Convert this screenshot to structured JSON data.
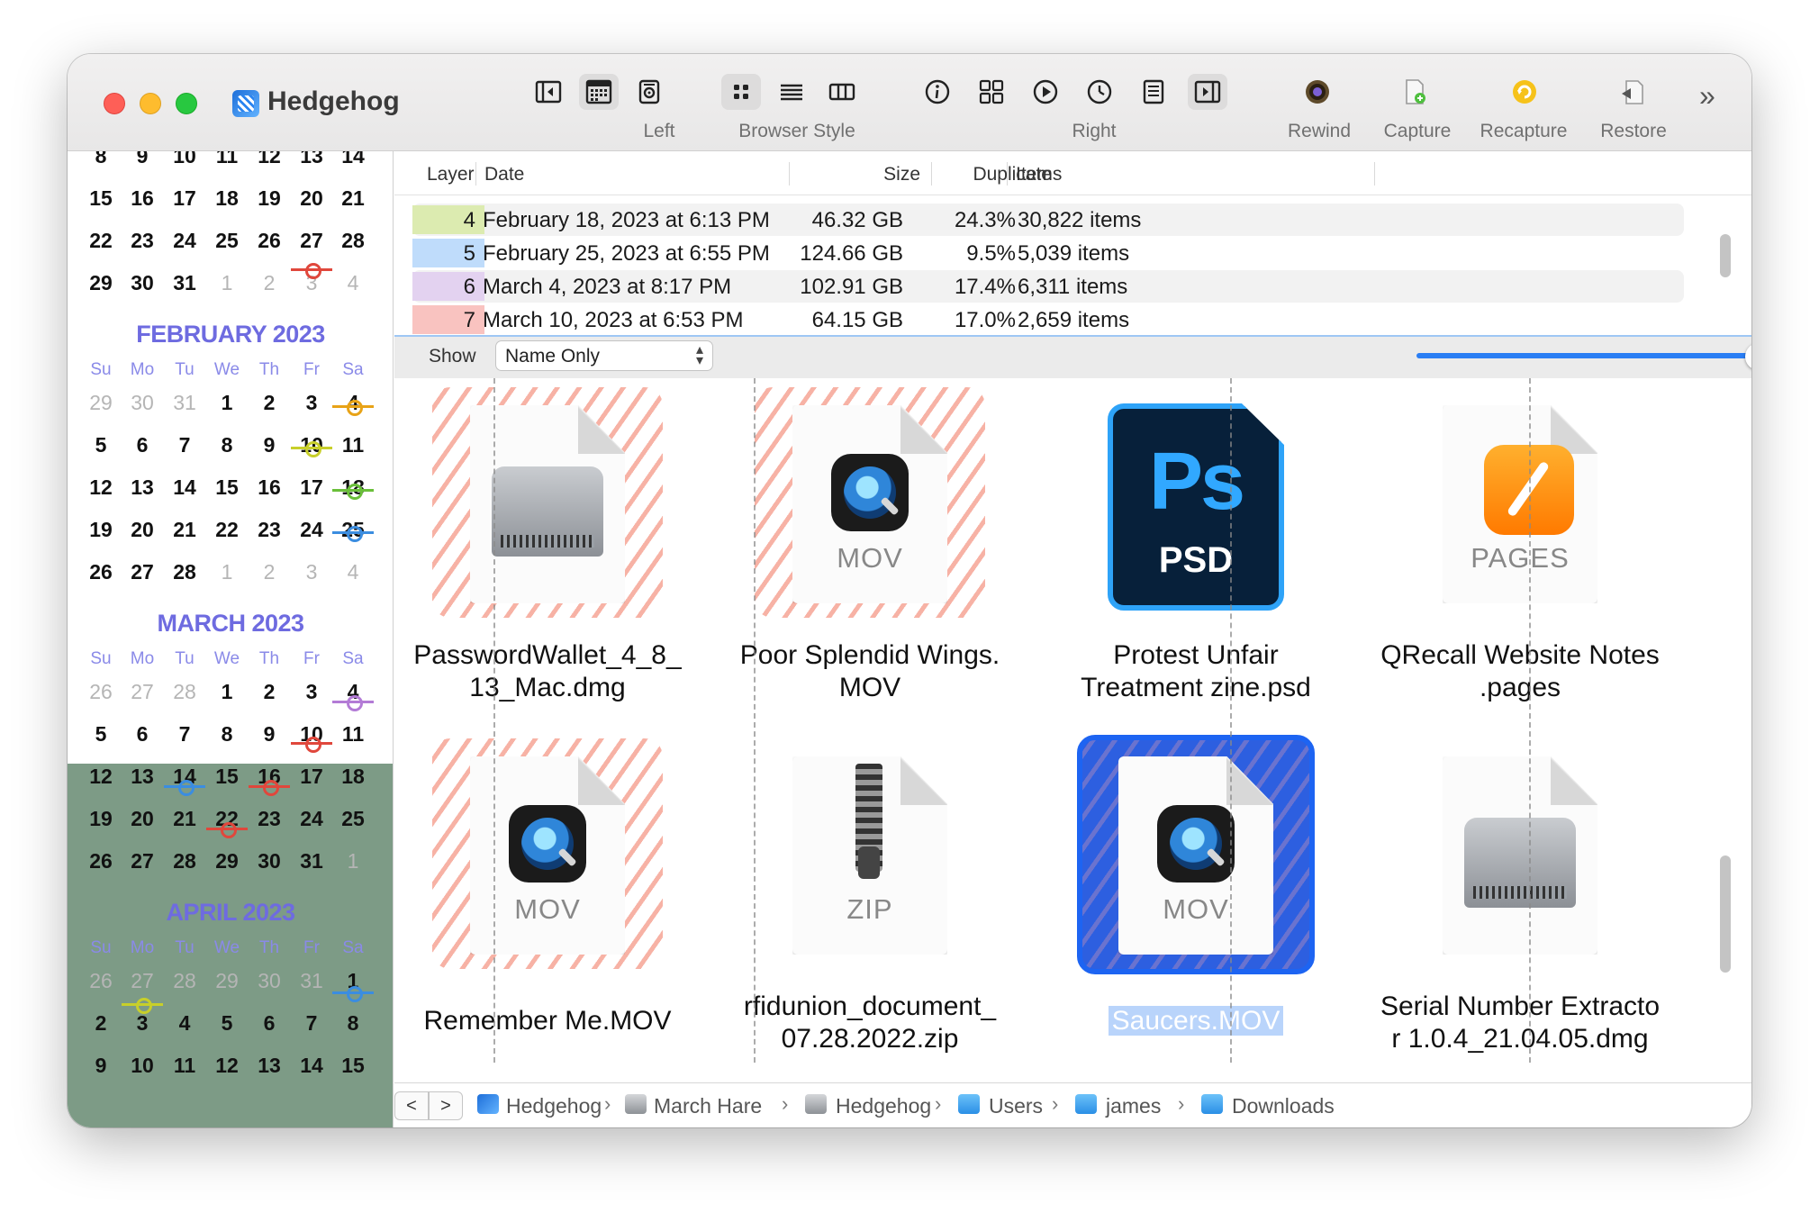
{
  "window": {
    "title": "Hedgehog"
  },
  "toolbar": {
    "groups": [
      {
        "label": "Left"
      },
      {
        "label": "Browser Style"
      },
      {
        "label": "Right"
      }
    ],
    "actions": [
      {
        "label": "Rewind",
        "icon": "rewind-icon"
      },
      {
        "label": "Capture",
        "icon": "capture-icon"
      },
      {
        "label": "Recapture",
        "icon": "recapture-icon"
      },
      {
        "label": "Restore",
        "icon": "restore-icon"
      }
    ],
    "overflow": "»"
  },
  "calendar": {
    "jan_rows": [
      [
        "8",
        "9",
        "10",
        "11",
        "12",
        "13",
        "14"
      ],
      [
        "15",
        "16",
        "17",
        "18",
        "19",
        "20",
        "21"
      ],
      [
        "22",
        "23",
        "24",
        "25",
        "26",
        "27",
        "28"
      ],
      [
        "29",
        "30",
        "31",
        "1",
        "2",
        "3",
        "4"
      ]
    ],
    "weekdays": [
      "Su",
      "Mo",
      "Tu",
      "We",
      "Th",
      "Fr",
      "Sa"
    ],
    "months": [
      {
        "title": "FEBRUARY 2023",
        "rows": [
          [
            "29",
            "30",
            "31",
            "1",
            "2",
            "3",
            "4"
          ],
          [
            "5",
            "6",
            "7",
            "8",
            "9",
            "10",
            "11"
          ],
          [
            "12",
            "13",
            "14",
            "15",
            "16",
            "17",
            "18"
          ],
          [
            "19",
            "20",
            "21",
            "22",
            "23",
            "24",
            "25"
          ],
          [
            "26",
            "27",
            "28",
            "1",
            "2",
            "3",
            "4"
          ]
        ]
      },
      {
        "title": "MARCH 2023",
        "rows": [
          [
            "26",
            "27",
            "28",
            "1",
            "2",
            "3",
            "4"
          ],
          [
            "5",
            "6",
            "7",
            "8",
            "9",
            "10",
            "11"
          ],
          [
            "12",
            "13",
            "14",
            "15",
            "16",
            "17",
            "18"
          ],
          [
            "19",
            "20",
            "21",
            "22",
            "23",
            "24",
            "25"
          ],
          [
            "26",
            "27",
            "28",
            "29",
            "30",
            "31",
            "1"
          ]
        ]
      },
      {
        "title": "APRIL 2023",
        "rows": [
          [
            "26",
            "27",
            "28",
            "29",
            "30",
            "31",
            "1"
          ],
          [
            "2",
            "3",
            "4",
            "5",
            "6",
            "7",
            "8"
          ],
          [
            "9",
            "10",
            "11",
            "12",
            "13",
            "14",
            "15"
          ]
        ]
      }
    ]
  },
  "table": {
    "headers": {
      "layer": "Layer",
      "date": "Date",
      "size": "Size",
      "duplicate": "Duplicate",
      "items": "Items"
    },
    "rows": [
      {
        "layer": "4",
        "date": "February 18, 2023 at 6:13 PM",
        "size": "46.32 GB",
        "duplicate": "24.3%",
        "items": "30,822 items",
        "color": "#dcebb0"
      },
      {
        "layer": "5",
        "date": "February 25, 2023 at 6:55 PM",
        "size": "124.66 GB",
        "duplicate": "9.5%",
        "items": "5,039 items",
        "color": "#bfdcfb"
      },
      {
        "layer": "6",
        "date": "March 4, 2023 at 8:17 PM",
        "size": "102.91 GB",
        "duplicate": "17.4%",
        "items": "6,311 items",
        "color": "#e3d2f0"
      },
      {
        "layer": "7",
        "date": "March 10, 2023 at 6:53 PM",
        "size": "64.15 GB",
        "duplicate": "17.0%",
        "items": "2,659 items",
        "color": "#f9c3c0"
      }
    ]
  },
  "show": {
    "label": "Show",
    "value": "Name Only"
  },
  "files": [
    {
      "name_l1": "PasswordWallet_4_8_",
      "name_l2": "13_Mac.dmg",
      "kind": ""
    },
    {
      "name_l1": "Poor Splendid Wings.",
      "name_l2": "MOV",
      "kind": "MOV"
    },
    {
      "name_l1": "Protest Unfair",
      "name_l2": "Treatment zine.psd",
      "kind": "PSD"
    },
    {
      "name_l1": "QRecall Website Notes",
      "name_l2": ".pages",
      "kind": "PAGES"
    },
    {
      "name_l1": "Remember Me.MOV",
      "name_l2": "",
      "kind": "MOV"
    },
    {
      "name_l1": "rfidunion_document_",
      "name_l2": "07.28.2022.zip",
      "kind": "ZIP"
    },
    {
      "name_l1": "Saucers.MOV",
      "name_l2": "",
      "kind": "MOV"
    },
    {
      "name_l1": "Serial Number Extracto",
      "name_l2": "r 1.0.4_21.04.05.dmg",
      "kind": ""
    }
  ],
  "ps_text": "Ps",
  "path": [
    "Hedgehog",
    "March Hare",
    "Hedgehog",
    "Users",
    "james",
    "Downloads"
  ],
  "nav": {
    "back": "<",
    "forward": ">"
  }
}
